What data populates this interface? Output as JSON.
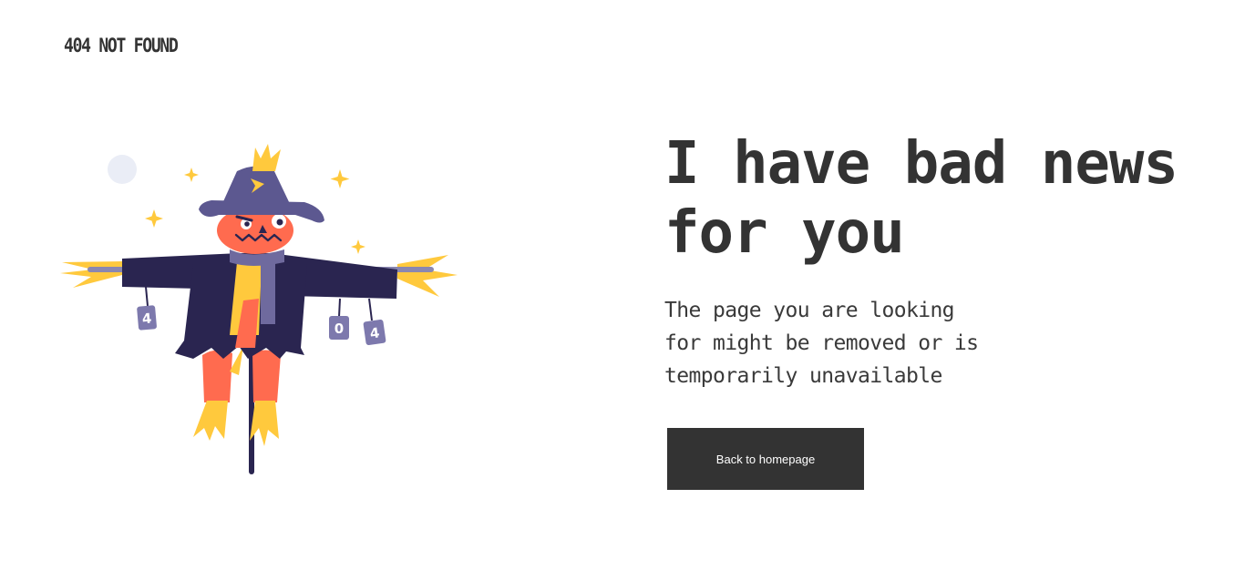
{
  "brand": {
    "label": "404 NOT FOUND"
  },
  "main": {
    "headline": "I have bad news for you",
    "message": "The page you are looking for might be removed or is temporarily unavailable",
    "home_button_label": "Back to homepage"
  },
  "illustration": {
    "subject": "scarecrow",
    "tag_digits": [
      "4",
      "0",
      "4"
    ],
    "colors": {
      "coat": "#2a2550",
      "hat": "#5c5890",
      "face": "#ff6b4f",
      "straw": "#ffc93d",
      "scarf": "#6f6a9e",
      "moon": "#eaedf6",
      "tags": "#7d79ad"
    }
  },
  "colors": {
    "text": "#333333",
    "button_bg": "#333333",
    "button_text": "#ffffff",
    "background": "#ffffff"
  }
}
